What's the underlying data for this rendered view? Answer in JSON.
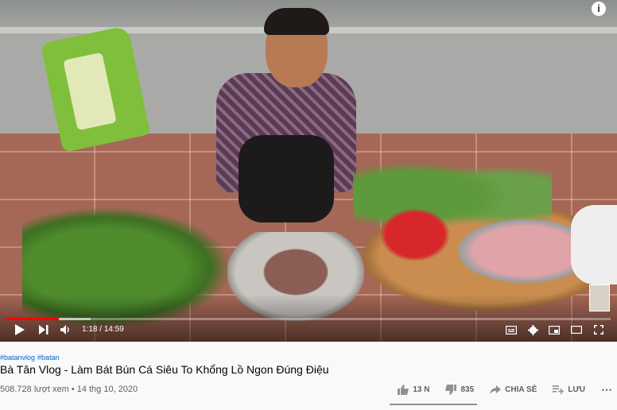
{
  "player": {
    "current_time": "1:18",
    "separator": "/",
    "duration": "14:59",
    "progress_fraction": 0.087,
    "buffer_fraction": 0.14,
    "accent_color": "#ff0000",
    "icons": {
      "play": "play-icon",
      "next": "next-icon",
      "volume": "volume-icon",
      "subtitles": "subtitles-icon",
      "settings": "gear-icon",
      "miniplayer": "miniplayer-icon",
      "theater": "theater-icon",
      "fullscreen": "fullscreen-icon",
      "info": "info-icon"
    },
    "info_label": "i"
  },
  "video": {
    "hashtags": [
      "#batanvlog",
      "#batan"
    ],
    "title": "Bà Tân Vlog - Làm Bát Bún Cá Siêu To Khổng Lồ Ngon Đúng Điệu",
    "views": "508.728 lượt xem",
    "date_separator": " • ",
    "date": "14 thg 10, 2020",
    "link_color": "#065fd4"
  },
  "actions": {
    "likes": "13 N",
    "dislikes": "835",
    "share_label": "CHIA SẺ",
    "save_label": "LƯU",
    "more_label": "⋯"
  }
}
